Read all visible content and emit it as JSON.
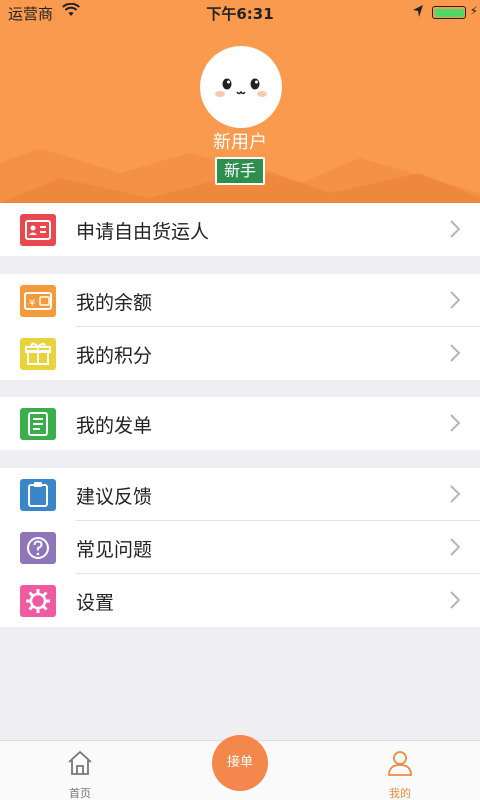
{
  "status_bar": {
    "carrier": "运营商",
    "time": "下午6:31"
  },
  "profile": {
    "username": "新用户",
    "badge": "新手"
  },
  "menu": [
    {
      "label": "申请自由货运人",
      "icon": "id-card-icon",
      "color": "#e8484e"
    },
    {
      "label": "我的余额",
      "icon": "wallet-icon",
      "color": "#f39a3b"
    },
    {
      "label": "我的积分",
      "icon": "gift-icon",
      "color": "#e8d43a"
    },
    {
      "label": "我的发单",
      "icon": "notebook-icon",
      "color": "#3aae4b"
    },
    {
      "label": "建议反馈",
      "icon": "clipboard-icon",
      "color": "#3a86c8"
    },
    {
      "label": "常见问题",
      "icon": "question-icon",
      "color": "#8e76b8"
    },
    {
      "label": "设置",
      "icon": "gear-icon",
      "color": "#ef5aa0"
    }
  ],
  "tabbar": {
    "home": "首页",
    "center": "接单",
    "mine": "我的"
  },
  "colors": {
    "accent": "#fa9a4f",
    "tab_active": "#f08a3c",
    "tab_inactive": "#777777"
  }
}
